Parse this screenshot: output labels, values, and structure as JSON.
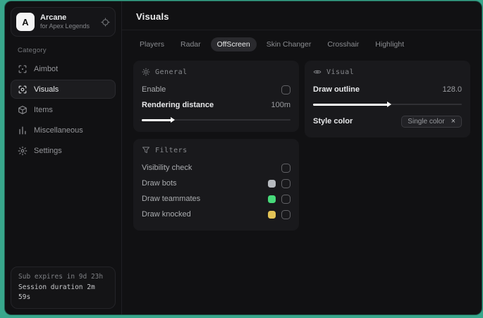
{
  "app": {
    "logo_letter": "A",
    "name": "Arcane",
    "subtitle": "for Apex Legends"
  },
  "sidebar": {
    "category_label": "Category",
    "items": [
      {
        "label": "Aimbot",
        "icon": "crosshair-icon"
      },
      {
        "label": "Visuals",
        "icon": "eye-scan-icon"
      },
      {
        "label": "Items",
        "icon": "box-icon"
      },
      {
        "label": "Miscellaneous",
        "icon": "bar-chart-icon"
      },
      {
        "label": "Settings",
        "icon": "gear-icon"
      }
    ],
    "footer": {
      "sub_expires": "Sub expires in 9d 23h",
      "session_duration": "Session duration 2m 59s"
    }
  },
  "header": {
    "title": "Visuals"
  },
  "tabs": [
    {
      "label": "Players"
    },
    {
      "label": "Radar"
    },
    {
      "label": "OffScreen"
    },
    {
      "label": "Skin Changer"
    },
    {
      "label": "Crosshair"
    },
    {
      "label": "Highlight"
    }
  ],
  "panels": {
    "general": {
      "title": "General",
      "icon": "sun-icon",
      "enable_label": "Enable",
      "rendering_distance_label": "Rendering distance",
      "rendering_distance_value": "100m",
      "rendering_distance_percent": 20
    },
    "filters": {
      "title": "Filters",
      "icon": "funnel-icon",
      "rows": [
        {
          "label": "Visibility check",
          "swatch": null
        },
        {
          "label": "Draw bots",
          "swatch": "#b7bbc0"
        },
        {
          "label": "Draw teammates",
          "swatch": "#47d97a"
        },
        {
          "label": "Draw knocked",
          "swatch": "#e2c356"
        }
      ]
    },
    "visual": {
      "title": "Visual",
      "icon": "eye-icon",
      "draw_outline_label": "Draw outline",
      "draw_outline_value": "128.0",
      "draw_outline_percent": 50,
      "style_color_label": "Style color",
      "style_color_selected": "Single color",
      "style_color_clear": "×"
    }
  },
  "colors": {
    "desktop_background": "#38a78c",
    "swatch_gray": "#b7bbc0",
    "swatch_green": "#47d97a",
    "swatch_yellow": "#e2c356"
  }
}
